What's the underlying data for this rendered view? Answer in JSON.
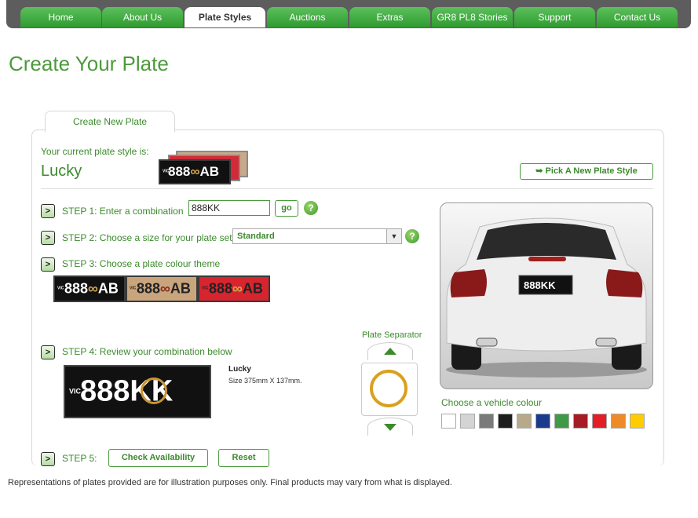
{
  "nav": {
    "tabs": [
      {
        "label": "Home"
      },
      {
        "label": "About Us"
      },
      {
        "label": "Plate Styles"
      },
      {
        "label": "Auctions"
      },
      {
        "label": "Extras"
      },
      {
        "label": "GR8 PL8 Stories"
      },
      {
        "label": "Support"
      },
      {
        "label": "Contact Us"
      }
    ],
    "active_index": 2
  },
  "page_title": "Create Your Plate",
  "panel_tab": "Create New Plate",
  "current_style": {
    "label": "Your current plate style is:",
    "name": "Lucky",
    "pick_button": "Pick A New Plate Style"
  },
  "step1": {
    "label": "STEP 1:  Enter a combination",
    "value": "888KK",
    "go": "go"
  },
  "step2": {
    "label": "STEP 2: Choose a size for your plate set",
    "selected": "Standard"
  },
  "step3": {
    "label": "STEP 3: Choose a plate colour theme"
  },
  "step4": {
    "label": "STEP 4: Review your combination below",
    "plate_name": "Lucky",
    "plate_size": "Size 375mm X 137mm."
  },
  "step5": {
    "label": "STEP 5:",
    "check_button": "Check Availability",
    "reset_button": "Reset"
  },
  "plate_separator": "Plate Separator",
  "vehicle_colour": {
    "label": "Choose a vehicle colour",
    "swatches": [
      "#ffffff",
      "#d4d4d4",
      "#7a7a7a",
      "#1e1e1e",
      "#b8a98a",
      "#1c3a8c",
      "#3e9a46",
      "#a51c24",
      "#e41e26",
      "#ee8a2a",
      "#ffcc00"
    ]
  },
  "plate_text": {
    "prefix": "888",
    "suffix": "AB",
    "review_suffix": "KK",
    "state": "VIC"
  },
  "icon_glyphs": {
    "step": ">",
    "help": "?",
    "back_arrow": "➥",
    "select_arrow": "▼"
  },
  "footnote": "Representations of plates provided are for illustration purposes only. Final products may vary from what is displayed."
}
